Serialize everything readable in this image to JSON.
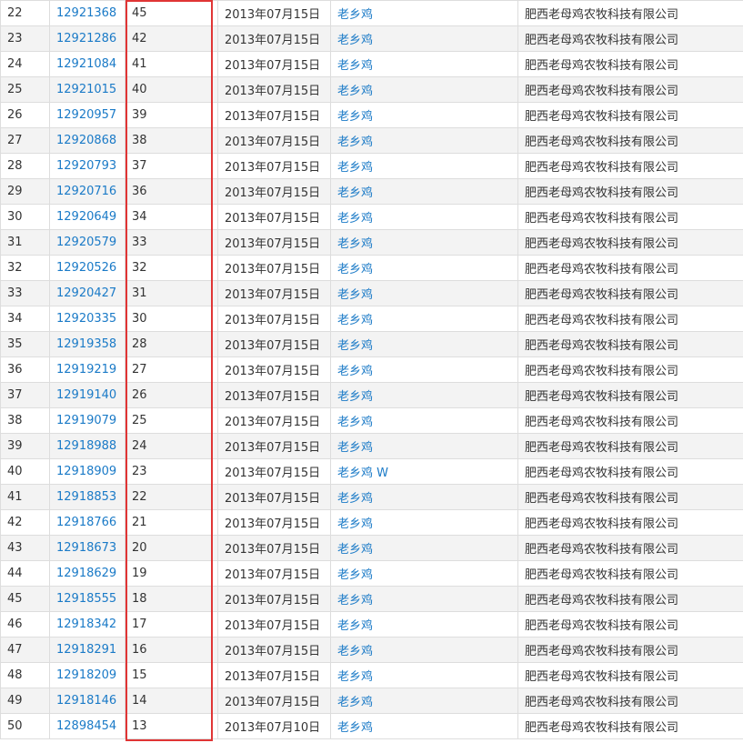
{
  "rows": [
    {
      "index": "22",
      "reg_no": "12921368",
      "class": "45",
      "date": "2013年07月15日",
      "name": "老乡鸡",
      "applicant": "肥西老母鸡农牧科技有限公司"
    },
    {
      "index": "23",
      "reg_no": "12921286",
      "class": "42",
      "date": "2013年07月15日",
      "name": "老乡鸡",
      "applicant": "肥西老母鸡农牧科技有限公司"
    },
    {
      "index": "24",
      "reg_no": "12921084",
      "class": "41",
      "date": "2013年07月15日",
      "name": "老乡鸡",
      "applicant": "肥西老母鸡农牧科技有限公司"
    },
    {
      "index": "25",
      "reg_no": "12921015",
      "class": "40",
      "date": "2013年07月15日",
      "name": "老乡鸡",
      "applicant": "肥西老母鸡农牧科技有限公司"
    },
    {
      "index": "26",
      "reg_no": "12920957",
      "class": "39",
      "date": "2013年07月15日",
      "name": "老乡鸡",
      "applicant": "肥西老母鸡农牧科技有限公司"
    },
    {
      "index": "27",
      "reg_no": "12920868",
      "class": "38",
      "date": "2013年07月15日",
      "name": "老乡鸡",
      "applicant": "肥西老母鸡农牧科技有限公司"
    },
    {
      "index": "28",
      "reg_no": "12920793",
      "class": "37",
      "date": "2013年07月15日",
      "name": "老乡鸡",
      "applicant": "肥西老母鸡农牧科技有限公司"
    },
    {
      "index": "29",
      "reg_no": "12920716",
      "class": "36",
      "date": "2013年07月15日",
      "name": "老乡鸡",
      "applicant": "肥西老母鸡农牧科技有限公司"
    },
    {
      "index": "30",
      "reg_no": "12920649",
      "class": "34",
      "date": "2013年07月15日",
      "name": "老乡鸡",
      "applicant": "肥西老母鸡农牧科技有限公司"
    },
    {
      "index": "31",
      "reg_no": "12920579",
      "class": "33",
      "date": "2013年07月15日",
      "name": "老乡鸡",
      "applicant": "肥西老母鸡农牧科技有限公司"
    },
    {
      "index": "32",
      "reg_no": "12920526",
      "class": "32",
      "date": "2013年07月15日",
      "name": "老乡鸡",
      "applicant": "肥西老母鸡农牧科技有限公司"
    },
    {
      "index": "33",
      "reg_no": "12920427",
      "class": "31",
      "date": "2013年07月15日",
      "name": "老乡鸡",
      "applicant": "肥西老母鸡农牧科技有限公司"
    },
    {
      "index": "34",
      "reg_no": "12920335",
      "class": "30",
      "date": "2013年07月15日",
      "name": "老乡鸡",
      "applicant": "肥西老母鸡农牧科技有限公司"
    },
    {
      "index": "35",
      "reg_no": "12919358",
      "class": "28",
      "date": "2013年07月15日",
      "name": "老乡鸡",
      "applicant": "肥西老母鸡农牧科技有限公司"
    },
    {
      "index": "36",
      "reg_no": "12919219",
      "class": "27",
      "date": "2013年07月15日",
      "name": "老乡鸡",
      "applicant": "肥西老母鸡农牧科技有限公司"
    },
    {
      "index": "37",
      "reg_no": "12919140",
      "class": "26",
      "date": "2013年07月15日",
      "name": "老乡鸡",
      "applicant": "肥西老母鸡农牧科技有限公司"
    },
    {
      "index": "38",
      "reg_no": "12919079",
      "class": "25",
      "date": "2013年07月15日",
      "name": "老乡鸡",
      "applicant": "肥西老母鸡农牧科技有限公司"
    },
    {
      "index": "39",
      "reg_no": "12918988",
      "class": "24",
      "date": "2013年07月15日",
      "name": "老乡鸡",
      "applicant": "肥西老母鸡农牧科技有限公司"
    },
    {
      "index": "40",
      "reg_no": "12918909",
      "class": "23",
      "date": "2013年07月15日",
      "name": "老乡鸡 W",
      "applicant": "肥西老母鸡农牧科技有限公司"
    },
    {
      "index": "41",
      "reg_no": "12918853",
      "class": "22",
      "date": "2013年07月15日",
      "name": "老乡鸡",
      "applicant": "肥西老母鸡农牧科技有限公司"
    },
    {
      "index": "42",
      "reg_no": "12918766",
      "class": "21",
      "date": "2013年07月15日",
      "name": "老乡鸡",
      "applicant": "肥西老母鸡农牧科技有限公司"
    },
    {
      "index": "43",
      "reg_no": "12918673",
      "class": "20",
      "date": "2013年07月15日",
      "name": "老乡鸡",
      "applicant": "肥西老母鸡农牧科技有限公司"
    },
    {
      "index": "44",
      "reg_no": "12918629",
      "class": "19",
      "date": "2013年07月15日",
      "name": "老乡鸡",
      "applicant": "肥西老母鸡农牧科技有限公司"
    },
    {
      "index": "45",
      "reg_no": "12918555",
      "class": "18",
      "date": "2013年07月15日",
      "name": "老乡鸡",
      "applicant": "肥西老母鸡农牧科技有限公司"
    },
    {
      "index": "46",
      "reg_no": "12918342",
      "class": "17",
      "date": "2013年07月15日",
      "name": "老乡鸡",
      "applicant": "肥西老母鸡农牧科技有限公司"
    },
    {
      "index": "47",
      "reg_no": "12918291",
      "class": "16",
      "date": "2013年07月15日",
      "name": "老乡鸡",
      "applicant": "肥西老母鸡农牧科技有限公司"
    },
    {
      "index": "48",
      "reg_no": "12918209",
      "class": "15",
      "date": "2013年07月15日",
      "name": "老乡鸡",
      "applicant": "肥西老母鸡农牧科技有限公司"
    },
    {
      "index": "49",
      "reg_no": "12918146",
      "class": "14",
      "date": "2013年07月15日",
      "name": "老乡鸡",
      "applicant": "肥西老母鸡农牧科技有限公司"
    },
    {
      "index": "50",
      "reg_no": "12898454",
      "class": "13",
      "date": "2013年07月10日",
      "name": "老乡鸡",
      "applicant": "肥西老母鸡农牧科技有限公司"
    }
  ],
  "colors": {
    "link": "#1a7ac7",
    "highlight_border": "#e03535",
    "row_alt": "#f3f3f3",
    "grid_line": "#dddddd"
  }
}
